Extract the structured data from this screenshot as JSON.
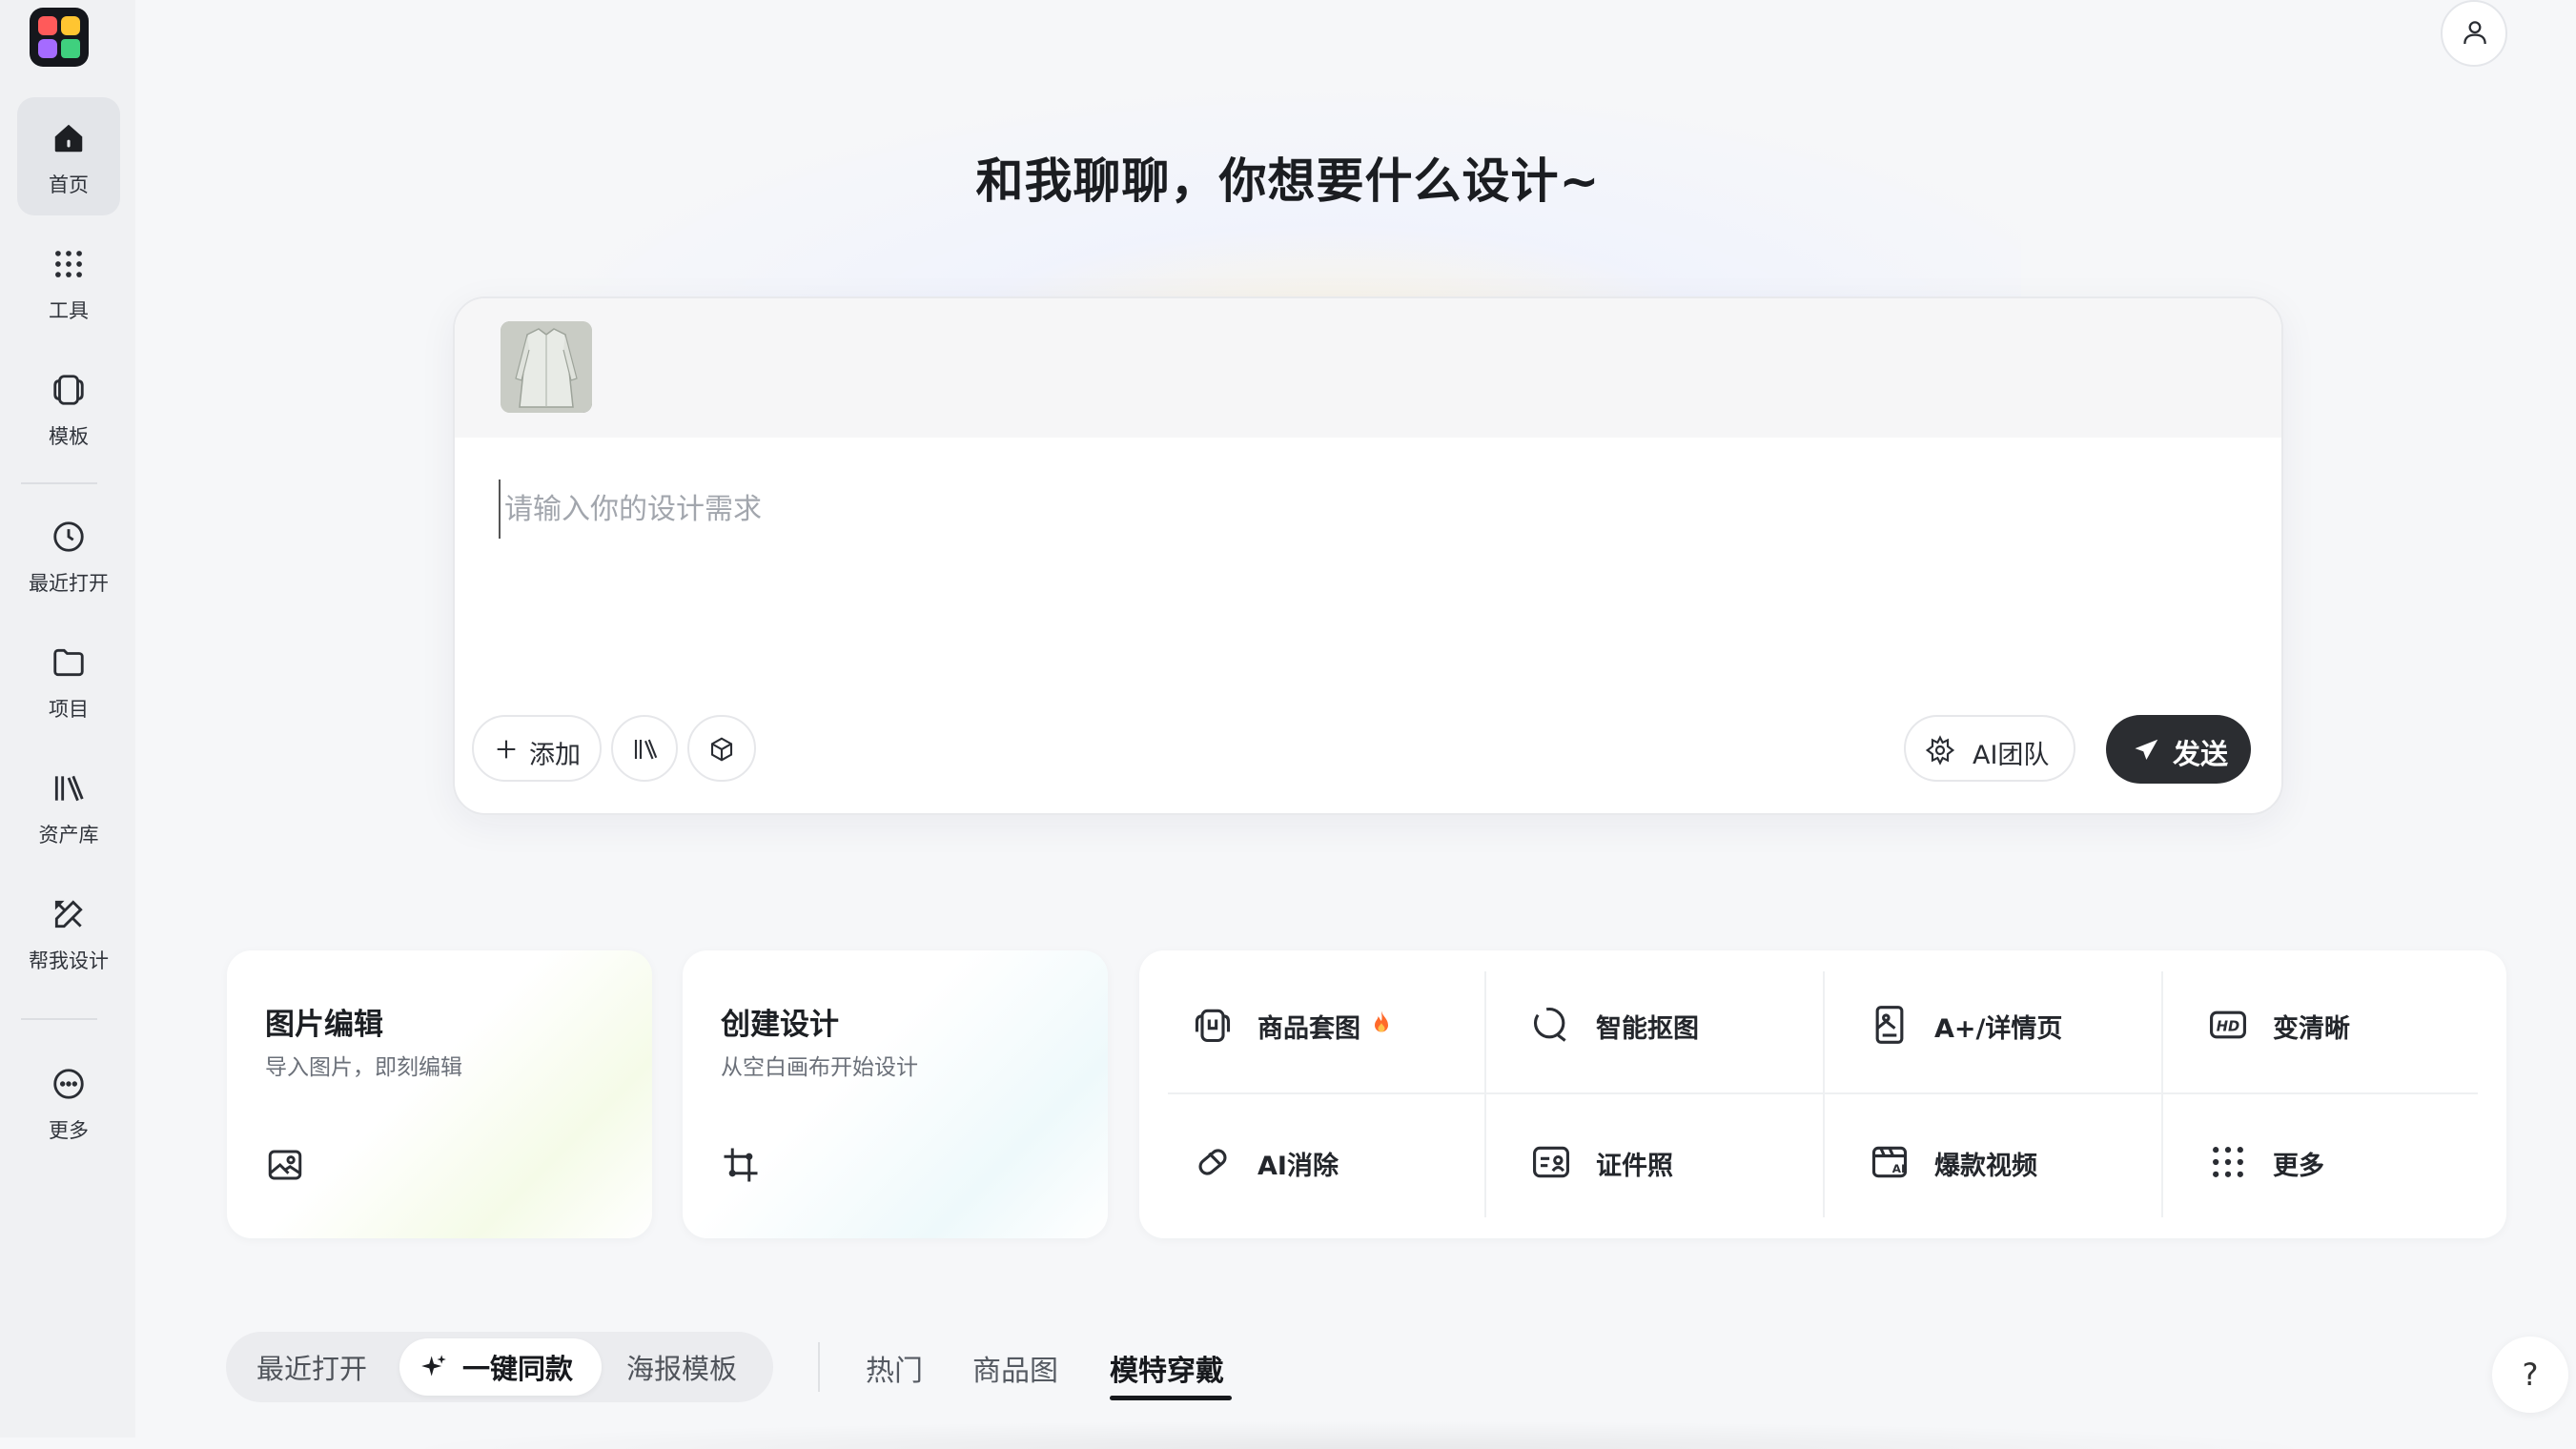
{
  "sidebar": {
    "items": [
      {
        "label": "首页",
        "icon": "home-icon"
      },
      {
        "label": "工具",
        "icon": "grid-dots-icon"
      },
      {
        "label": "模板",
        "icon": "template-icon"
      },
      {
        "label": "最近打开",
        "icon": "clock-icon"
      },
      {
        "label": "项目",
        "icon": "folder-icon"
      },
      {
        "label": "资产库",
        "icon": "library-icon"
      },
      {
        "label": "帮我设计",
        "icon": "design-tools-icon"
      },
      {
        "label": "更多",
        "icon": "more-icon"
      }
    ]
  },
  "header": {
    "headline": "和我聊聊，你想要什么设计~"
  },
  "composer": {
    "placeholder": "请输入你的设计需求",
    "add_label": "添加",
    "ai_team_label": "AI团队",
    "send_label": "发送"
  },
  "cards": {
    "image_edit": {
      "title": "图片编辑",
      "subtitle": "导入图片，即刻编辑"
    },
    "create_design": {
      "title": "创建设计",
      "subtitle": "从空白画布开始设计"
    }
  },
  "tools": [
    {
      "label": "商品套图",
      "icon": "product-set-icon"
    },
    {
      "label": "智能抠图",
      "icon": "cutout-icon"
    },
    {
      "label": "A+/详情页",
      "icon": "detail-page-icon"
    },
    {
      "label": "变清晰",
      "icon": "hd-icon"
    },
    {
      "label": "AI消除",
      "icon": "eraser-icon"
    },
    {
      "label": "证件照",
      "icon": "id-photo-icon"
    },
    {
      "label": "爆款视频",
      "icon": "video-ai-icon"
    },
    {
      "label": "更多",
      "icon": "grid-dots-icon"
    }
  ],
  "bottom": {
    "segments": [
      "最近打开",
      "一键同款",
      "海报模板"
    ],
    "tabs": [
      "热门",
      "商品图",
      "模特穿戴"
    ],
    "help_label": "?"
  },
  "colors": {
    "send_button": "#2b2d31",
    "hot_flame": "#ff6a2b"
  }
}
